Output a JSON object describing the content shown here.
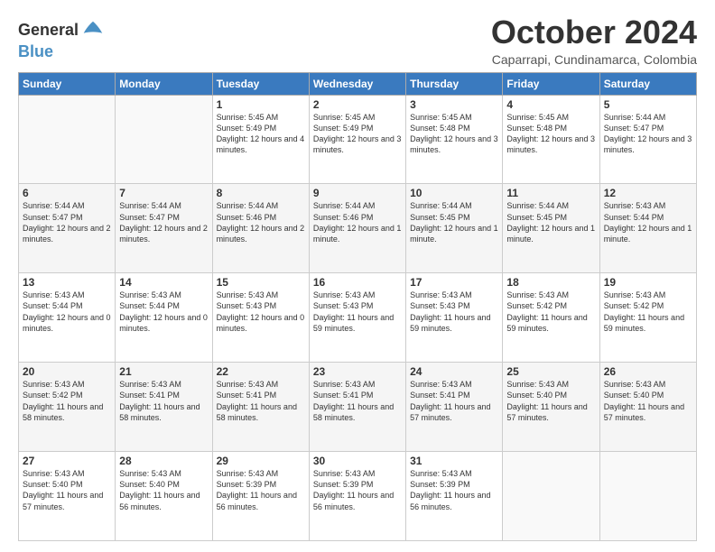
{
  "logo": {
    "line1": "General",
    "line2": "Blue",
    "icon_color": "#4a90c4"
  },
  "header": {
    "title": "October 2024",
    "subtitle": "Caparrapi, Cundinamarca, Colombia"
  },
  "days_of_week": [
    "Sunday",
    "Monday",
    "Tuesday",
    "Wednesday",
    "Thursday",
    "Friday",
    "Saturday"
  ],
  "weeks": [
    [
      {
        "day": "",
        "sunrise": "",
        "sunset": "",
        "daylight": ""
      },
      {
        "day": "",
        "sunrise": "",
        "sunset": "",
        "daylight": ""
      },
      {
        "day": "1",
        "sunrise": "Sunrise: 5:45 AM",
        "sunset": "Sunset: 5:49 PM",
        "daylight": "Daylight: 12 hours and 4 minutes."
      },
      {
        "day": "2",
        "sunrise": "Sunrise: 5:45 AM",
        "sunset": "Sunset: 5:49 PM",
        "daylight": "Daylight: 12 hours and 3 minutes."
      },
      {
        "day": "3",
        "sunrise": "Sunrise: 5:45 AM",
        "sunset": "Sunset: 5:48 PM",
        "daylight": "Daylight: 12 hours and 3 minutes."
      },
      {
        "day": "4",
        "sunrise": "Sunrise: 5:45 AM",
        "sunset": "Sunset: 5:48 PM",
        "daylight": "Daylight: 12 hours and 3 minutes."
      },
      {
        "day": "5",
        "sunrise": "Sunrise: 5:44 AM",
        "sunset": "Sunset: 5:47 PM",
        "daylight": "Daylight: 12 hours and 3 minutes."
      }
    ],
    [
      {
        "day": "6",
        "sunrise": "Sunrise: 5:44 AM",
        "sunset": "Sunset: 5:47 PM",
        "daylight": "Daylight: 12 hours and 2 minutes."
      },
      {
        "day": "7",
        "sunrise": "Sunrise: 5:44 AM",
        "sunset": "Sunset: 5:47 PM",
        "daylight": "Daylight: 12 hours and 2 minutes."
      },
      {
        "day": "8",
        "sunrise": "Sunrise: 5:44 AM",
        "sunset": "Sunset: 5:46 PM",
        "daylight": "Daylight: 12 hours and 2 minutes."
      },
      {
        "day": "9",
        "sunrise": "Sunrise: 5:44 AM",
        "sunset": "Sunset: 5:46 PM",
        "daylight": "Daylight: 12 hours and 1 minute."
      },
      {
        "day": "10",
        "sunrise": "Sunrise: 5:44 AM",
        "sunset": "Sunset: 5:45 PM",
        "daylight": "Daylight: 12 hours and 1 minute."
      },
      {
        "day": "11",
        "sunrise": "Sunrise: 5:44 AM",
        "sunset": "Sunset: 5:45 PM",
        "daylight": "Daylight: 12 hours and 1 minute."
      },
      {
        "day": "12",
        "sunrise": "Sunrise: 5:43 AM",
        "sunset": "Sunset: 5:44 PM",
        "daylight": "Daylight: 12 hours and 1 minute."
      }
    ],
    [
      {
        "day": "13",
        "sunrise": "Sunrise: 5:43 AM",
        "sunset": "Sunset: 5:44 PM",
        "daylight": "Daylight: 12 hours and 0 minutes."
      },
      {
        "day": "14",
        "sunrise": "Sunrise: 5:43 AM",
        "sunset": "Sunset: 5:44 PM",
        "daylight": "Daylight: 12 hours and 0 minutes."
      },
      {
        "day": "15",
        "sunrise": "Sunrise: 5:43 AM",
        "sunset": "Sunset: 5:43 PM",
        "daylight": "Daylight: 12 hours and 0 minutes."
      },
      {
        "day": "16",
        "sunrise": "Sunrise: 5:43 AM",
        "sunset": "Sunset: 5:43 PM",
        "daylight": "Daylight: 11 hours and 59 minutes."
      },
      {
        "day": "17",
        "sunrise": "Sunrise: 5:43 AM",
        "sunset": "Sunset: 5:43 PM",
        "daylight": "Daylight: 11 hours and 59 minutes."
      },
      {
        "day": "18",
        "sunrise": "Sunrise: 5:43 AM",
        "sunset": "Sunset: 5:42 PM",
        "daylight": "Daylight: 11 hours and 59 minutes."
      },
      {
        "day": "19",
        "sunrise": "Sunrise: 5:43 AM",
        "sunset": "Sunset: 5:42 PM",
        "daylight": "Daylight: 11 hours and 59 minutes."
      }
    ],
    [
      {
        "day": "20",
        "sunrise": "Sunrise: 5:43 AM",
        "sunset": "Sunset: 5:42 PM",
        "daylight": "Daylight: 11 hours and 58 minutes."
      },
      {
        "day": "21",
        "sunrise": "Sunrise: 5:43 AM",
        "sunset": "Sunset: 5:41 PM",
        "daylight": "Daylight: 11 hours and 58 minutes."
      },
      {
        "day": "22",
        "sunrise": "Sunrise: 5:43 AM",
        "sunset": "Sunset: 5:41 PM",
        "daylight": "Daylight: 11 hours and 58 minutes."
      },
      {
        "day": "23",
        "sunrise": "Sunrise: 5:43 AM",
        "sunset": "Sunset: 5:41 PM",
        "daylight": "Daylight: 11 hours and 58 minutes."
      },
      {
        "day": "24",
        "sunrise": "Sunrise: 5:43 AM",
        "sunset": "Sunset: 5:41 PM",
        "daylight": "Daylight: 11 hours and 57 minutes."
      },
      {
        "day": "25",
        "sunrise": "Sunrise: 5:43 AM",
        "sunset": "Sunset: 5:40 PM",
        "daylight": "Daylight: 11 hours and 57 minutes."
      },
      {
        "day": "26",
        "sunrise": "Sunrise: 5:43 AM",
        "sunset": "Sunset: 5:40 PM",
        "daylight": "Daylight: 11 hours and 57 minutes."
      }
    ],
    [
      {
        "day": "27",
        "sunrise": "Sunrise: 5:43 AM",
        "sunset": "Sunset: 5:40 PM",
        "daylight": "Daylight: 11 hours and 57 minutes."
      },
      {
        "day": "28",
        "sunrise": "Sunrise: 5:43 AM",
        "sunset": "Sunset: 5:40 PM",
        "daylight": "Daylight: 11 hours and 56 minutes."
      },
      {
        "day": "29",
        "sunrise": "Sunrise: 5:43 AM",
        "sunset": "Sunset: 5:39 PM",
        "daylight": "Daylight: 11 hours and 56 minutes."
      },
      {
        "day": "30",
        "sunrise": "Sunrise: 5:43 AM",
        "sunset": "Sunset: 5:39 PM",
        "daylight": "Daylight: 11 hours and 56 minutes."
      },
      {
        "day": "31",
        "sunrise": "Sunrise: 5:43 AM",
        "sunset": "Sunset: 5:39 PM",
        "daylight": "Daylight: 11 hours and 56 minutes."
      },
      {
        "day": "",
        "sunrise": "",
        "sunset": "",
        "daylight": ""
      },
      {
        "day": "",
        "sunrise": "",
        "sunset": "",
        "daylight": ""
      }
    ]
  ]
}
